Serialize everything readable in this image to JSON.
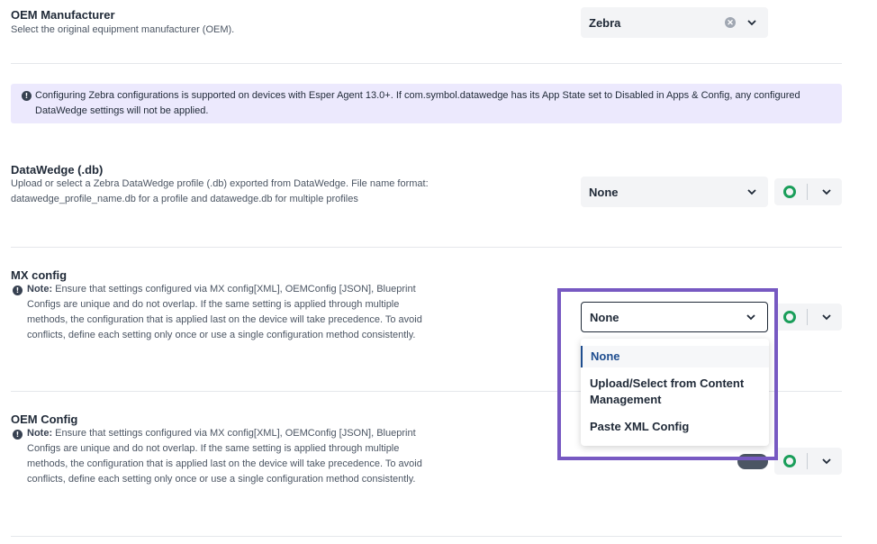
{
  "oem": {
    "title": "OEM Manufacturer",
    "description": "Select the original equipment manufacturer (OEM).",
    "value": "Zebra"
  },
  "banner": {
    "text": "Configuring Zebra configurations is supported on devices with Esper Agent 13.0+. If com.symbol.datawedge has its App State set to Disabled in Apps & Config, any configured DataWedge settings will not be applied."
  },
  "datawedge": {
    "title": "DataWedge (.db)",
    "description": "Upload or select a Zebra DataWedge profile (.db) exported from DataWedge. File name format: datawedge_profile_name.db for a profile and datawedge.db for multiple profiles",
    "value": "None"
  },
  "mx_config": {
    "title": "MX config",
    "note_label": "Note:",
    "note_text": " Ensure that settings configured via MX config[XML], OEMConfig [JSON], Blueprint Configs are unique and do not overlap. If the same setting is applied through multiple methods, the configuration that is applied last on the device will take precedence. To avoid conflicts, define each setting only once or use a single configuration method consistently.",
    "value": "None",
    "dropdown": {
      "options": [
        "None",
        "Upload/Select from Content Management",
        "Paste XML Config"
      ],
      "selected": "None"
    }
  },
  "oem_config": {
    "title": "OEM Config",
    "note_label": "Note:",
    "note_text": " Ensure that settings configured via MX config[XML], OEMConfig [JSON], Blueprint Configs are unique and do not overlap. If the same setting is applied through multiple methods, the configuration that is applied last on the device will take precedence. To avoid conflicts, define each setting only once or use a single configuration method consistently."
  },
  "colors": {
    "accent_purple": "#7759c2",
    "banner_bg": "#ece9fd",
    "status_green": "#1a9e5a",
    "selected_blue": "#1e4d8f"
  },
  "icons": {
    "info": "info-circle-icon",
    "clear": "clear-icon",
    "chevron": "chevron-down-icon",
    "status": "status-ring-icon"
  }
}
